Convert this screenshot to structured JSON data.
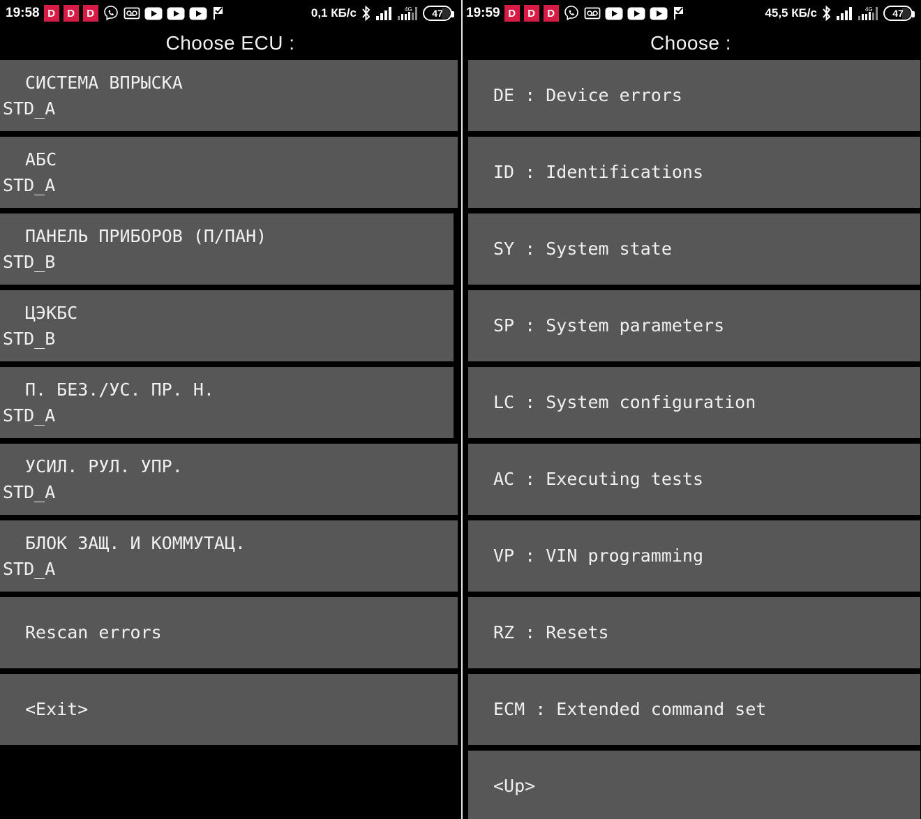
{
  "left": {
    "statusbar": {
      "time": "19:58",
      "badges": [
        "D",
        "D",
        "D"
      ],
      "icons": [
        "viber-icon",
        "voicemail-icon",
        "youtube-icon",
        "youtube-icon",
        "youtube-icon",
        "checkmark-flag-icon"
      ],
      "data_rate": "0,1 КБ/с",
      "right_icons": [
        "bluetooth-icon",
        "signal-bars-icon",
        "4g-signal-icon"
      ],
      "battery_level": "47"
    },
    "title": "Choose ECU :",
    "items": [
      {
        "line1": "СИСТЕМА ВПРЫСКА",
        "line2": "STD_A"
      },
      {
        "line1": "АБС",
        "line2": "STD_A"
      },
      {
        "line1": "ПАНЕЛЬ ПРИБОРОВ (П/ПАН)",
        "line2": "STD_B"
      },
      {
        "line1": "ЦЭКБС",
        "line2": "STD_B"
      },
      {
        "line1": "П. БЕЗ./УС. ПР. Н.",
        "line2": "STD_A"
      },
      {
        "line1": "УСИЛ. РУЛ. УПР.",
        "line2": "STD_A"
      },
      {
        "line1": "БЛОК ЗАЩ. И КОММУТАЦ.",
        "line2": "STD_A"
      },
      {
        "line1": "Rescan errors",
        "line2": ""
      },
      {
        "line1": "<Exit>",
        "line2": ""
      }
    ]
  },
  "right": {
    "statusbar": {
      "time": "19:59",
      "badges": [
        "D",
        "D",
        "D"
      ],
      "icons": [
        "viber-icon",
        "voicemail-icon",
        "youtube-icon",
        "youtube-icon",
        "youtube-icon",
        "checkmark-flag-icon"
      ],
      "data_rate": "45,5 КБ/с",
      "right_icons": [
        "bluetooth-icon",
        "signal-bars-icon",
        "4g-signal-icon"
      ],
      "battery_level": "47"
    },
    "title": "Choose :",
    "items": [
      {
        "line1": "DE : Device errors",
        "line2": ""
      },
      {
        "line1": "ID : Identifications",
        "line2": ""
      },
      {
        "line1": "SY : System state",
        "line2": ""
      },
      {
        "line1": "SP : System parameters",
        "line2": ""
      },
      {
        "line1": "LC : System configuration",
        "line2": ""
      },
      {
        "line1": "AC : Executing tests",
        "line2": ""
      },
      {
        "line1": "VP : VIN programming",
        "line2": ""
      },
      {
        "line1": "RZ : Resets",
        "line2": ""
      },
      {
        "line1": "ECM : Extended command set",
        "line2": ""
      },
      {
        "line1": "<Up>",
        "line2": ""
      }
    ]
  },
  "colors": {
    "background": "#000000",
    "item_background": "#575757",
    "text": "#f0f0f0",
    "badge_red": "#d81b45"
  }
}
